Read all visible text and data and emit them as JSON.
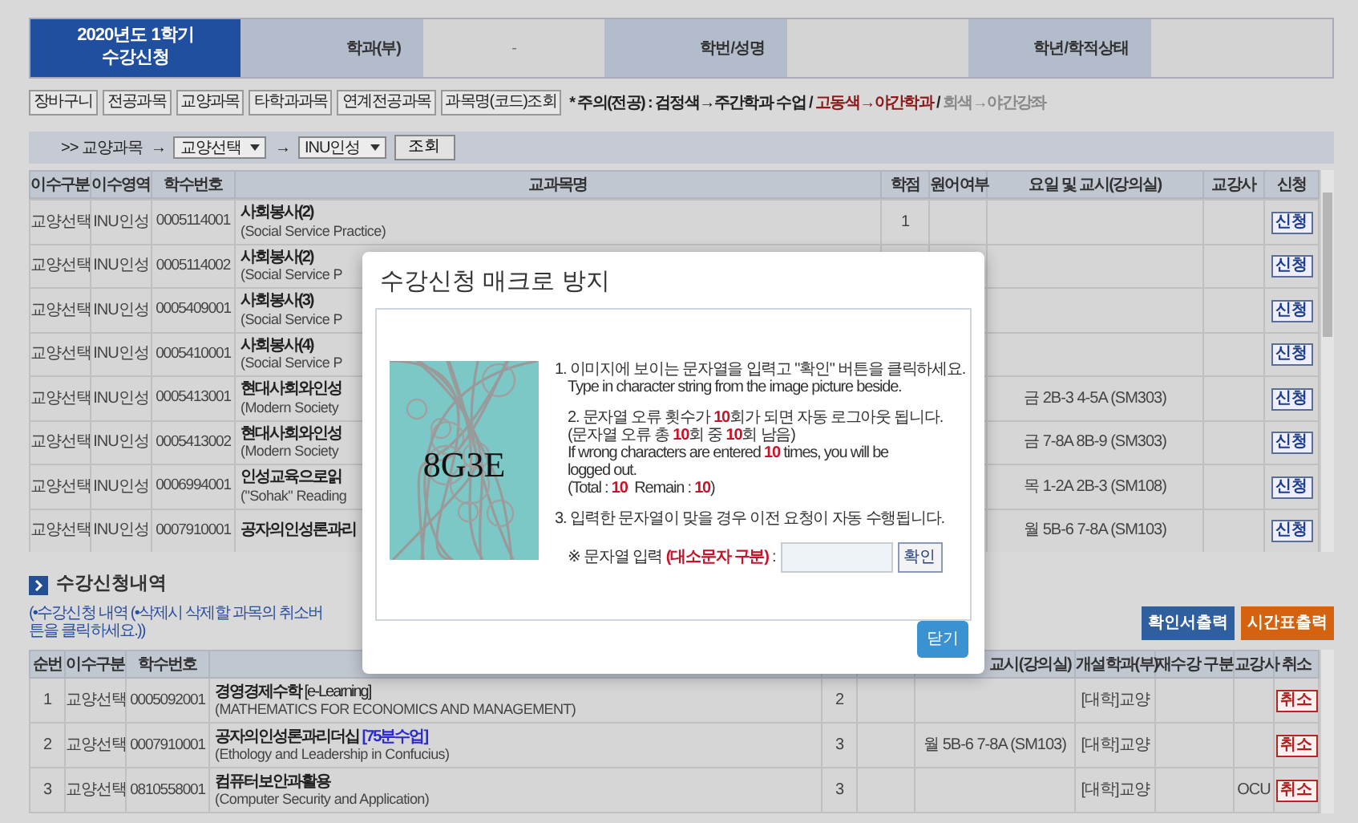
{
  "header": {
    "term": "2020년도 1학기",
    "title": "수강신청",
    "fields": [
      {
        "label": "학과(부)",
        "value": "-"
      },
      {
        "label": "학번/성명"
      },
      {
        "label": "학년/학적상태"
      }
    ]
  },
  "menu_buttons": [
    "장바구니",
    "전공과목",
    "교양과목",
    "타학과과목",
    "연계전공과목",
    "과목명(코드)조회"
  ],
  "notice": [
    {
      "text": "* 주의(전공) : 검정색→주간학과 수업 /",
      "color": "#222222"
    },
    {
      "text": "고동색→야간학과",
      "color": "#8b1a1a"
    },
    {
      "text": "/",
      "color": "#222222"
    },
    {
      "text": "회색→야간강좌",
      "color": "#8a8a8a"
    }
  ],
  "filter": {
    "prefix": ">> 교양과목",
    "arrow_1": "→",
    "select_1": "교양선택",
    "arrow_2": "→",
    "select_2": "INU인성",
    "button": "조회"
  },
  "course_table": {
    "columns": [
      "이수구분",
      "이수영역",
      "학수번호",
      "교과목명",
      "학점",
      "원어여부",
      "요일 및 교시(강의실)",
      "교강사",
      "신청"
    ],
    "rows": [
      {
        "type": "교양선택",
        "area": "INU인성",
        "code": "0005114001",
        "title": "사회봉사(2)",
        "subtitle": "(Social Service Practice)",
        "credits": "1",
        "apply": "신청"
      },
      {
        "type": "교양선택",
        "area": "INU인성",
        "code": "0005114002",
        "title": "사회봉사(2)",
        "subtitle": "(Social Service P",
        "apply": "신청"
      },
      {
        "type": "교양선택",
        "area": "INU인성",
        "code": "0005409001",
        "title": "사회봉사(3)",
        "subtitle": "(Social Service P",
        "apply": "신청"
      },
      {
        "type": "교양선택",
        "area": "INU인성",
        "code": "0005410001",
        "title": "사회봉사(4)",
        "subtitle": "(Social Service P",
        "apply": "신청"
      },
      {
        "type": "교양선택",
        "area": "INU인성",
        "code": "0005413001",
        "title": "현대사회와인성",
        "subtitle": "(Modern Society",
        "schedule": "금 2B-3 4-5A (SM303)",
        "apply": "신청"
      },
      {
        "type": "교양선택",
        "area": "INU인성",
        "code": "0005413002",
        "title": "현대사회와인성",
        "subtitle": "(Modern Society",
        "schedule": "금 7-8A 8B-9 (SM303)",
        "apply": "신청"
      },
      {
        "type": "교양선택",
        "area": "INU인성",
        "code": "0006994001",
        "title": "인성교육으로읽",
        "subtitle": "(\"Sohak\" Reading",
        "schedule": "목 1-2A 2B-3 (SM108)",
        "apply": "신청"
      },
      {
        "type": "교양선택",
        "area": "INU인성",
        "code": "0007910001",
        "title": "공자의인성론과리",
        "schedule": "월 5B-6 7-8A (SM103)",
        "apply": "신청"
      }
    ]
  },
  "history": {
    "title": "수강신청내역",
    "note": "(•수강신청 내역 (•삭제시 삭제할 과목의 취소버튼을 클릭하세요.))",
    "buttons": [
      {
        "label": "확인서출력",
        "color": "#2f5f9e"
      },
      {
        "label": "시간표출력",
        "color": "#d5620f"
      }
    ],
    "columns": [
      "순번",
      "이수구분",
      "학수번호",
      "",
      "",
      "",
      "교시(강의실)",
      "개설학과(부)",
      "재수강 구분",
      "교강사",
      "취소"
    ],
    "rows": [
      {
        "no": "1",
        "type": "교양선택",
        "code": "0005092001",
        "title": "경영경제수학",
        "tag": "[e-Learning]",
        "tag_highlight": false,
        "subtitle": "(MATHEMATICS FOR ECONOMICS AND MANAGEMENT)",
        "credits": "2",
        "dept": "[대학]교양",
        "cancel": "취소"
      },
      {
        "no": "2",
        "type": "교양선택",
        "code": "0007910001",
        "title": "공자의인성론과리더십",
        "tag": "[75분수업]",
        "tag_highlight": true,
        "subtitle": "(Ethology and Leadership in Confucius)",
        "credits": "3",
        "schedule": "월 5B-6 7-8A (SM103)",
        "dept": "[대학]교양",
        "cancel": "취소"
      },
      {
        "no": "3",
        "type": "교양선택",
        "code": "0810558001",
        "title": "컴퓨터보안과활용",
        "subtitle": "(Computer Security and Application)",
        "credits": "3",
        "dept": "[대학]교양",
        "professor": "OCU",
        "cancel": "취소"
      }
    ]
  },
  "modal": {
    "title": "수강신청 매크로 방지",
    "captcha_text": "8G3E",
    "lines": [
      [
        {
          "text": "1. 이미지에 보이는 문자열을 입력고 \"확인\" 버튼을 클릭하세요.",
          "emphasis": false
        }
      ],
      [
        {
          "text": "Type in character string from the image picture beside.",
          "emphasis": false
        }
      ],
      [
        {
          "text": "2. 문자열 오류 횟수가 ",
          "emphasis": false
        },
        {
          "text": "10",
          "emphasis": true
        },
        {
          "text": "회가 되면 자동 로그아웃 됩니다.",
          "emphasis": false
        }
      ],
      [
        {
          "text": "(문자열 오류 총 ",
          "emphasis": false
        },
        {
          "text": "10",
          "emphasis": true
        },
        {
          "text": "회 중 ",
          "emphasis": false
        },
        {
          "text": "10",
          "emphasis": true
        },
        {
          "text": "회 남음)",
          "emphasis": false
        }
      ],
      [
        {
          "text": "If wrong characters are entered ",
          "emphasis": false
        },
        {
          "text": "10",
          "emphasis": true
        },
        {
          "text": " times, you will be",
          "emphasis": false
        }
      ],
      [
        {
          "text": "logged out.",
          "emphasis": false
        }
      ],
      [
        {
          "text": "(Total : ",
          "emphasis": false
        },
        {
          "text": "10",
          "emphasis": true
        },
        {
          "text": "  Remain : ",
          "emphasis": false
        },
        {
          "text": "10",
          "emphasis": true
        },
        {
          "text": ")",
          "emphasis": false
        }
      ],
      [
        {
          "text": "3. 입력한 문자열이 맞을 경우 이전 요청이 자동 수행됩니다.",
          "emphasis": false
        }
      ]
    ],
    "input_label": [
      {
        "text": "※ 문자열 입력 ",
        "emphasis": false
      },
      {
        "text": "(대소문자 구분)",
        "emphasis": true
      },
      {
        "text": " :",
        "emphasis": false
      }
    ],
    "confirm": "확인",
    "close": "닫기"
  }
}
